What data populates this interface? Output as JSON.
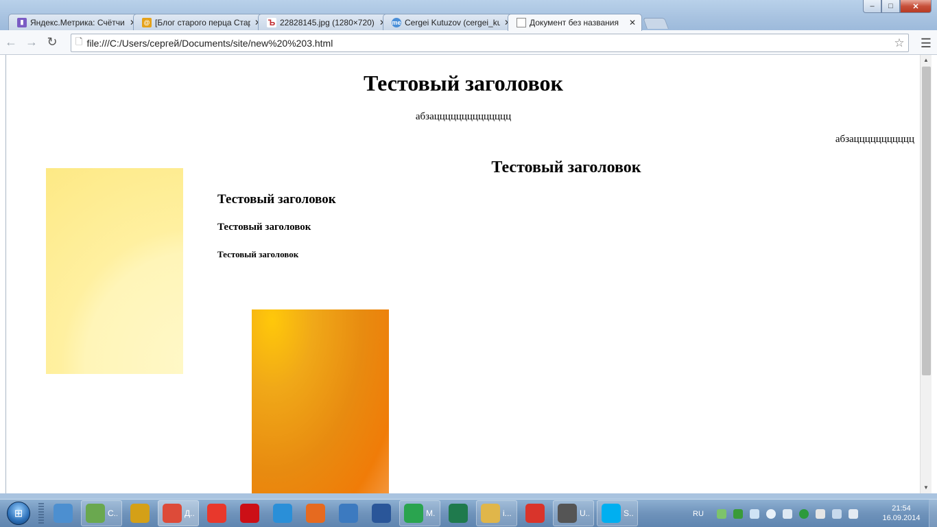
{
  "window": {
    "min": "–",
    "max": "□",
    "close": "✕"
  },
  "tabs": [
    {
      "title": "Яндекс.Метрика: Счётчи",
      "icon": "metrika-icon",
      "color": "#7b5cc4"
    },
    {
      "title": "[Блог старого перца Стар",
      "icon": "blog-icon",
      "color": "#e5a21a"
    },
    {
      "title": "22828145.jpg (1280×720)",
      "icon": "image-site-icon",
      "color": "#c0282d"
    },
    {
      "title": "Cergei Kutuzov (cergei_ku",
      "icon": "profile-icon",
      "color": "#4a8fd8"
    },
    {
      "title": "Документ без названия",
      "icon": "page-icon",
      "color": "#ffffff"
    }
  ],
  "toolbar": {
    "url": "file:///C:/Users/сергей/Documents/site/new%20%203.html"
  },
  "page": {
    "h1": "Тестовый заголовок",
    "p1": "абзацццццццццццццц",
    "p2": "абзаццццццццццц",
    "h2": "Тестовый заголовок",
    "h3": "Тестовый заголовок",
    "h4": "Тестовый заголовок",
    "h5": "Тестовый заголовок"
  },
  "taskbar": {
    "items": [
      {
        "label": "",
        "icon": "paint-icon",
        "color": "#4c8fd0",
        "type": "pin"
      },
      {
        "label": "C...",
        "icon": "notepad-icon",
        "color": "#6aa84f",
        "type": "btn"
      },
      {
        "label": "",
        "icon": "agent-icon",
        "color": "#d4a017",
        "type": "pin"
      },
      {
        "label": "Д...",
        "icon": "chrome-icon",
        "color": "#dd4b39",
        "type": "btn-on"
      },
      {
        "label": "",
        "icon": "yandex-browser-icon",
        "color": "#e8382c",
        "type": "pin"
      },
      {
        "label": "",
        "icon": "opera-icon",
        "color": "#cc0f16",
        "type": "pin"
      },
      {
        "label": "",
        "icon": "ie-icon",
        "color": "#2a8fd8",
        "type": "pin"
      },
      {
        "label": "",
        "icon": "firefox-icon",
        "color": "#e66a1f",
        "type": "pin"
      },
      {
        "label": "",
        "icon": "safari-icon",
        "color": "#3c7ac0",
        "type": "pin"
      },
      {
        "label": "",
        "icon": "word-icon",
        "color": "#2a5699",
        "type": "pin"
      },
      {
        "label": "M...",
        "icon": "mail-agent-icon",
        "color": "#2aa44f",
        "type": "btn"
      },
      {
        "label": "",
        "icon": "circuit-icon",
        "color": "#1f7a4d",
        "type": "pin"
      },
      {
        "label": "i...",
        "icon": "folder-icon",
        "color": "#e0b64a",
        "type": "btn"
      },
      {
        "label": "",
        "icon": "sketchup-icon",
        "color": "#d9342b",
        "type": "pin"
      },
      {
        "label": "U...",
        "icon": "utility-icon",
        "color": "#555555",
        "type": "btn"
      },
      {
        "label": "S...",
        "icon": "skype-icon",
        "color": "#00aff0",
        "type": "btn"
      }
    ],
    "lang": "RU",
    "time": "21:54",
    "date": "16.09.2014"
  }
}
